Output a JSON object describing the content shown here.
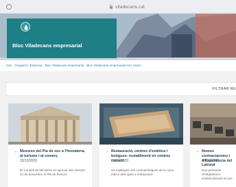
{
  "browser": {
    "url": "viladecans.cat"
  },
  "hero": {
    "title": "Bloc Viladecans empresarial"
  },
  "breadcrumb": {
    "text": "Inici · Ocupació i Empresa · Bloc Viladecans empresarial · Bloc Viladecans empresarial Inici Home"
  },
  "filter": {
    "label": "FILTRAR RE"
  },
  "articles": [
    {
      "title": "Mesures del Pla de xoc a l'hostaleria, al turisme i al comerç",
      "date": "23/12/2020",
      "excerpt": "El Consell de Ministres va aprovar ahir dimarts 22 de desembre el Pla de Rescat"
    },
    {
      "title": "Restauració, centres d'estètica i botigues: restabliment en centres comerc",
      "date": "21/12/2020",
      "excerpt": "Us expliquem les característiques de la nova edició dels ajuts a restauració"
    },
    {
      "title": "Nomes contractacions i d'Experiència del Laboral",
      "date": "14/12/2020",
      "excerpt": "Dos persones d'establiment d'administració en pre"
    }
  ]
}
